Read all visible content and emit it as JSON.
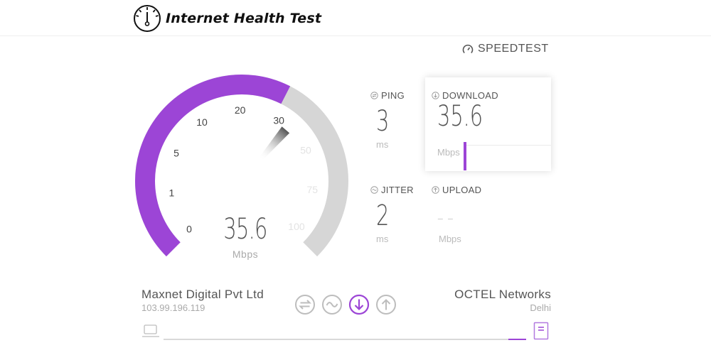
{
  "header": {
    "title": "Internet Health Test",
    "logo_icon": "speedometer-icon"
  },
  "provider_logo": {
    "text": "SPEEDTEST",
    "icon": "gauge-logo-icon"
  },
  "gauge": {
    "scale_labels": [
      "0",
      "1",
      "5",
      "10",
      "20",
      "30",
      "50",
      "75",
      "100"
    ],
    "value": "35.6",
    "unit": "Mbps",
    "fill_fraction": 0.6,
    "needle_value": 35.6,
    "colors": {
      "fill": "#9c45d6",
      "track": "#d6d6d6"
    }
  },
  "metrics": {
    "ping": {
      "label": "PING",
      "value": "3",
      "unit": "ms",
      "icon": "ping-icon"
    },
    "download": {
      "label": "DOWNLOAD",
      "value": "35.6",
      "unit": "Mbps",
      "icon": "download-icon"
    },
    "jitter": {
      "label": "JITTER",
      "value": "2",
      "unit": "ms",
      "icon": "jitter-icon"
    },
    "upload": {
      "label": "UPLOAD",
      "value": "– –",
      "unit": "Mbps",
      "icon": "upload-icon"
    }
  },
  "isp": {
    "name": "Maxnet Digital Pvt Ltd",
    "ip": "103.99.196.119"
  },
  "server": {
    "name": "OCTEL Networks",
    "location": "Delhi"
  },
  "stages": [
    {
      "name": "ping",
      "icon": "ping-stage-icon",
      "active": false
    },
    {
      "name": "jitter",
      "icon": "jitter-stage-icon",
      "active": false
    },
    {
      "name": "download",
      "icon": "download-stage-icon",
      "active": true
    },
    {
      "name": "upload",
      "icon": "upload-stage-icon",
      "active": false
    }
  ],
  "connection_progress": 0.95,
  "colors": {
    "accent": "#9c45d6",
    "muted": "#bdbdbd",
    "text": "#555555"
  }
}
